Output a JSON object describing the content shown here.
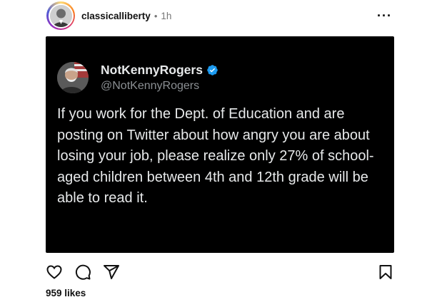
{
  "post": {
    "username": "classicalliberty",
    "separator": "•",
    "time": "1h",
    "more_label": "···",
    "likes": "959 likes"
  },
  "tweet": {
    "name": "NotKennyRogers",
    "handle": "@NotKennyRogers",
    "text": "If you work for the Dept. of Education and are posting on Twitter about how angry you are about losing your job, please realize only 27% of school-aged children between 4th and 12th grade will be able to read it."
  },
  "icons": {
    "like": "heart-icon",
    "comment": "comment-bubble-icon",
    "share": "paper-plane-icon",
    "save": "bookmark-icon",
    "verified": "verified-badge-icon"
  },
  "colors": {
    "tweet_background": "#000000",
    "verified_blue": "#1d9bf0",
    "muted_text": "#777777"
  }
}
